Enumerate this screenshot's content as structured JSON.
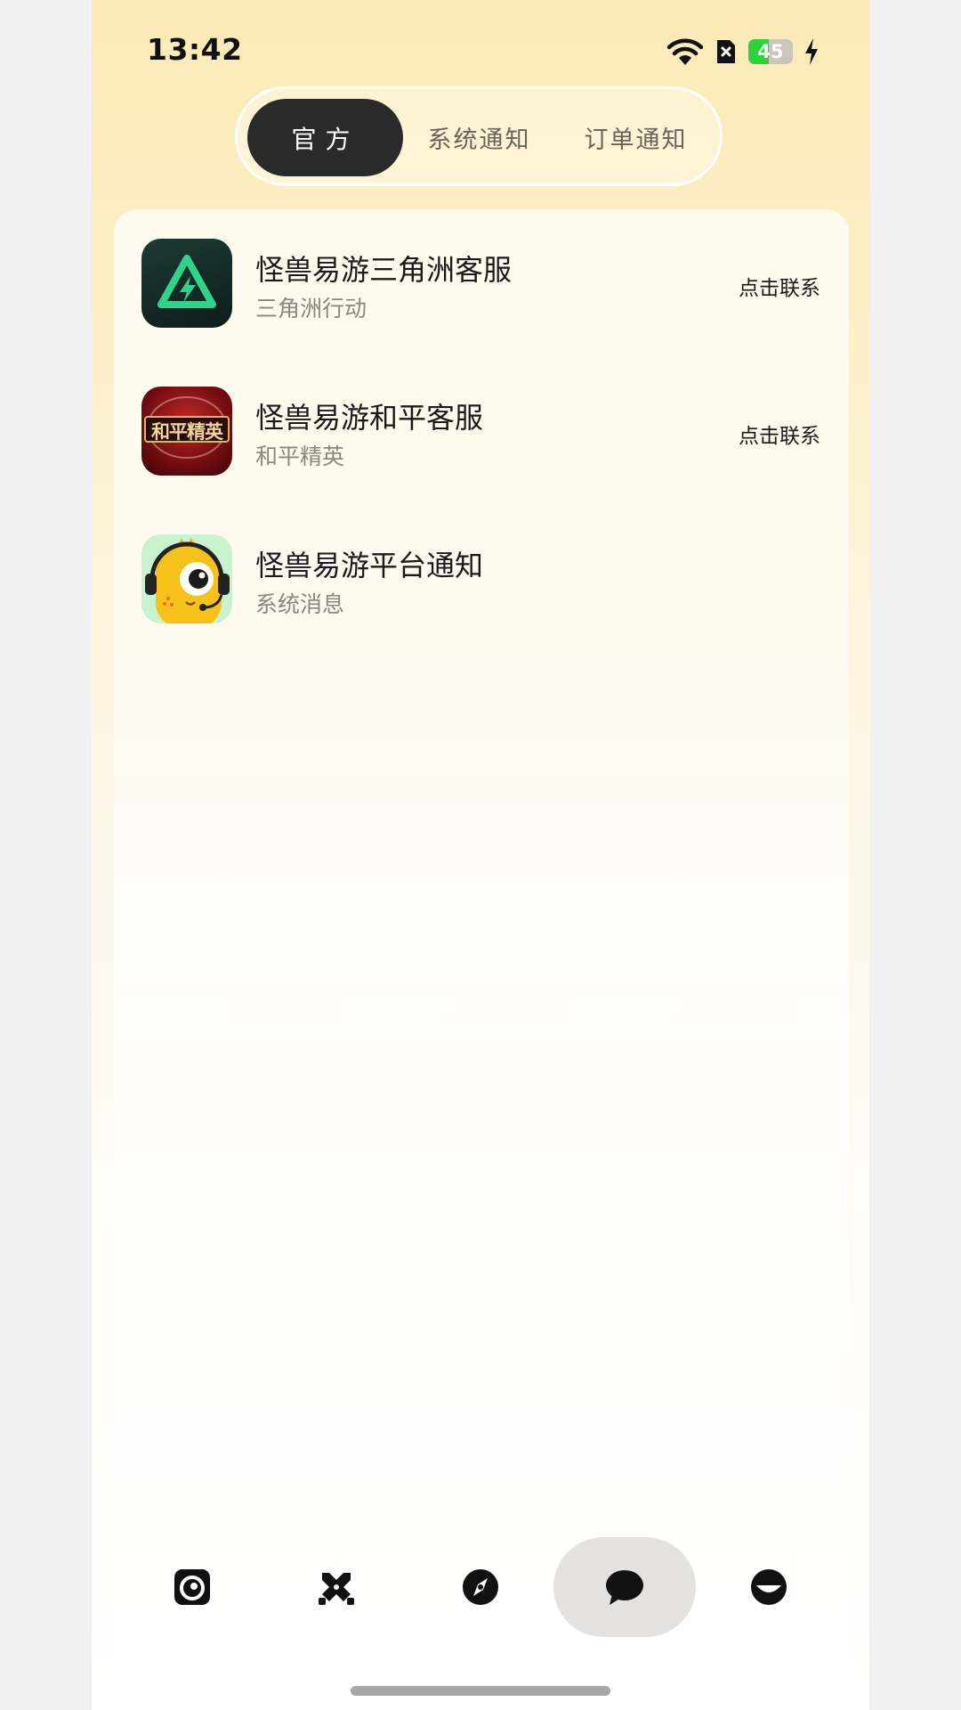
{
  "status_bar": {
    "time": "13:42",
    "battery_level": "45",
    "icons": [
      "wifi-icon",
      "sim-off-icon",
      "battery-icon",
      "charging-bolt-icon"
    ]
  },
  "tabs": [
    {
      "label": "官方",
      "active": true
    },
    {
      "label": "系统通知",
      "active": false
    },
    {
      "label": "订单通知",
      "active": false
    }
  ],
  "list": [
    {
      "title": "怪兽易游三角洲客服",
      "subtitle": "三角洲行动",
      "action": "点击联系",
      "avatar": "delta-force-logo"
    },
    {
      "title": "怪兽易游和平客服",
      "subtitle": "和平精英",
      "action": "点击联系",
      "avatar": "peace-elite-logo",
      "avatar_text": "和平精英"
    },
    {
      "title": "怪兽易游平台通知",
      "subtitle": "系统消息",
      "action": "",
      "avatar": "mascot-headset-logo"
    }
  ],
  "bottom_nav": [
    {
      "icon": "camera-icon",
      "active": false
    },
    {
      "icon": "crossed-swords-icon",
      "active": false
    },
    {
      "icon": "compass-icon",
      "active": false
    },
    {
      "icon": "chat-bubble-icon",
      "active": true
    },
    {
      "icon": "profile-icon",
      "active": false
    }
  ],
  "colors": {
    "active_tab_bg": "#2a2a2a",
    "background_top": "#fbeab6",
    "battery_green": "#2bd23e",
    "delta_green": "#2fd38a"
  }
}
